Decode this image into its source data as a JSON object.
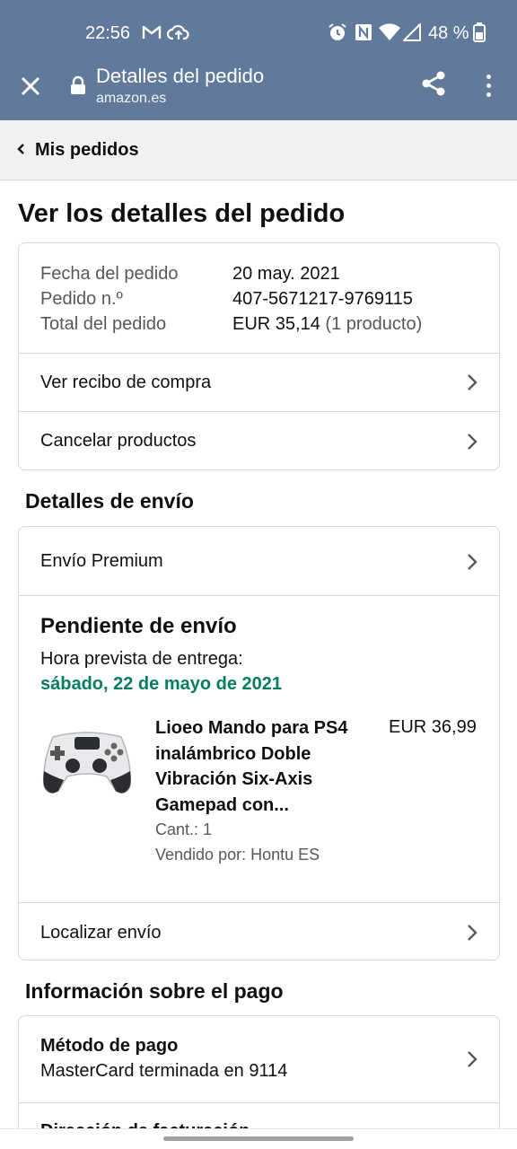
{
  "status_bar": {
    "time": "22:56",
    "battery": "48 %",
    "icons": [
      "gmail-icon",
      "cloud-upload-icon",
      "alarm-icon",
      "nfc-icon",
      "wifi-icon",
      "signal-icon",
      "battery-icon"
    ]
  },
  "toolbar": {
    "title": "Detalles del pedido",
    "url": "amazon.es"
  },
  "breadcrumb": {
    "label": "Mis pedidos"
  },
  "page_title": "Ver los detalles del pedido",
  "order_summary": {
    "date_label": "Fecha del pedido",
    "date_value": "20 may. 2021",
    "number_label": "Pedido n.º",
    "number_value": "407-5671217-9769115",
    "total_label": "Total del pedido",
    "total_value": "EUR 35,14",
    "total_items": "(1 producto)"
  },
  "order_actions": {
    "receipt": "Ver recibo de compra",
    "cancel": "Cancelar productos"
  },
  "shipping": {
    "heading": "Detalles de envío",
    "method": "Envío Premium",
    "status": "Pendiente de envío",
    "eta_label": "Hora prevista de entrega:",
    "eta_date": "sábado, 22 de mayo de 2021",
    "product": {
      "title_lines": [
        "Lioeo Mando para PS4",
        "inalámbrico Doble",
        "Vibración Six-Axis",
        "Gamepad con..."
      ],
      "price": "EUR 36,99",
      "qty": "Cant.: 1",
      "seller": "Vendido por: Hontu ES"
    },
    "track": "Localizar envío"
  },
  "payment": {
    "heading": "Información sobre el pago",
    "method_label": "Método de pago",
    "method_value": "MasterCard terminada en 9114",
    "billing_label": "Dirección de facturación"
  },
  "colors": {
    "chrome": "#61799a",
    "eta_green": "#067d62"
  }
}
